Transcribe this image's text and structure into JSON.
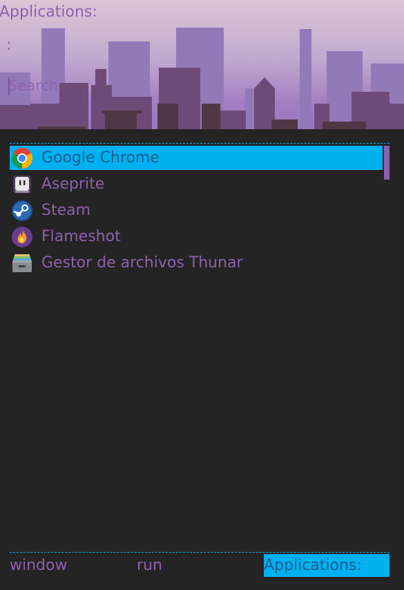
{
  "header": {
    "mode_label": "Applications:",
    "prompt_colon": ":",
    "search_placeholder": "Search"
  },
  "apps": [
    {
      "label": "Google Chrome",
      "icon": "chrome-icon",
      "selected": true
    },
    {
      "label": "Aseprite",
      "icon": "aseprite-icon",
      "selected": false
    },
    {
      "label": "Steam",
      "icon": "steam-icon",
      "selected": false
    },
    {
      "label": "Flameshot",
      "icon": "flameshot-icon",
      "selected": false
    },
    {
      "label": "Gestor de archivos Thunar",
      "icon": "thunar-icon",
      "selected": false
    }
  ],
  "modes": [
    {
      "label": "window",
      "active": false
    },
    {
      "label": "run",
      "active": false
    },
    {
      "label": "Applications:",
      "active": true
    }
  ],
  "colors": {
    "background": "#242424",
    "text": "#8e5fae",
    "highlight": "#00b1f0",
    "highlight_text": "#1e5c8e"
  }
}
